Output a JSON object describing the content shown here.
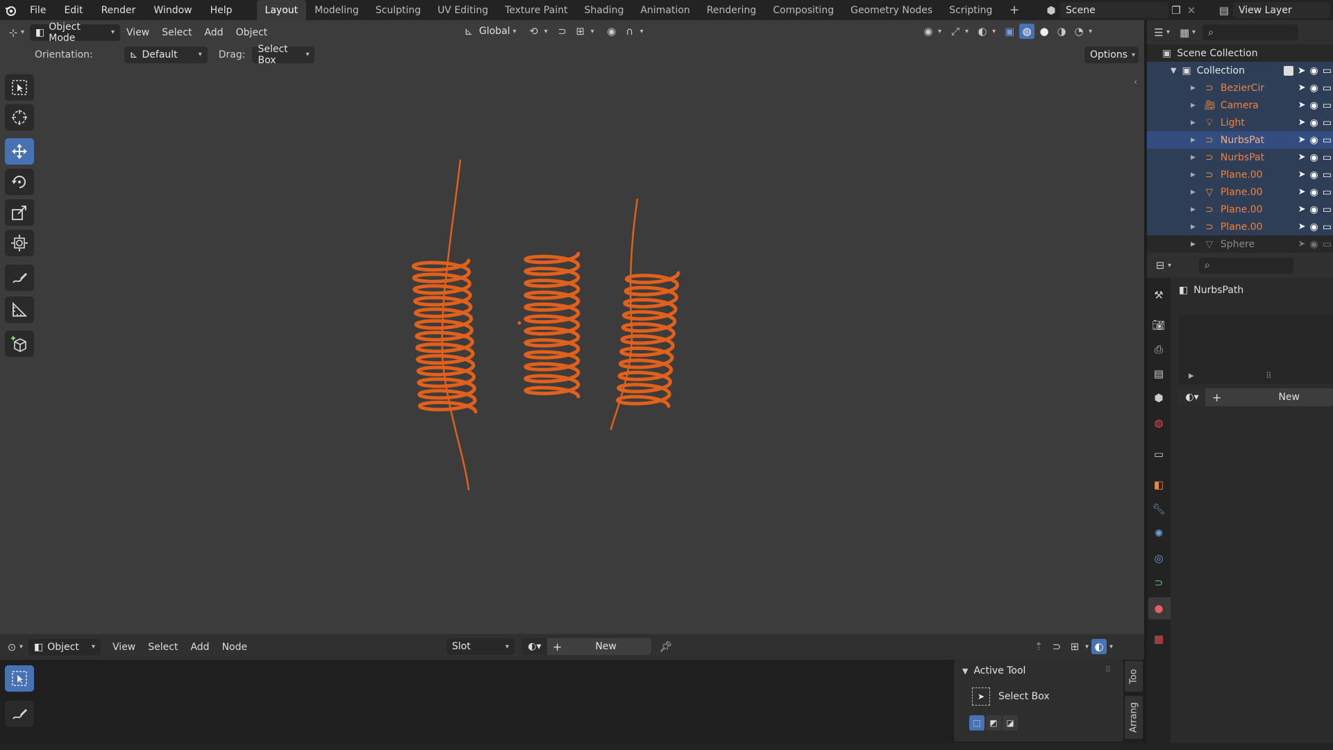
{
  "menus": [
    "File",
    "Edit",
    "Render",
    "Window",
    "Help"
  ],
  "workspaces": [
    "Layout",
    "Modeling",
    "Sculpting",
    "UV Editing",
    "Texture Paint",
    "Shading",
    "Animation",
    "Rendering",
    "Compositing",
    "Geometry Nodes",
    "Scripting"
  ],
  "active_workspace": "Layout",
  "scene": {
    "name": "Scene"
  },
  "view_layer": {
    "name": "View Layer"
  },
  "viewport_header": {
    "mode": "Object Mode",
    "menus": [
      "View",
      "Select",
      "Add",
      "Object"
    ],
    "orientation_transform": "Global"
  },
  "tool_header": {
    "orientation_label": "Orientation:",
    "orientation_value": "Default",
    "drag_label": "Drag:",
    "drag_value": "Select Box",
    "options": "Options"
  },
  "outliner": {
    "scene_collection": "Scene Collection",
    "collection": "Collection",
    "objects": [
      {
        "name": "BezierCir",
        "icon": "curve-icon"
      },
      {
        "name": "Camera",
        "icon": "camera-icon"
      },
      {
        "name": "Light",
        "icon": "light-icon"
      },
      {
        "name": "NurbsPat",
        "icon": "curve-icon"
      },
      {
        "name": "NurbsPat",
        "icon": "curve-icon"
      },
      {
        "name": "Plane.00",
        "icon": "curve-icon"
      },
      {
        "name": "Plane.00",
        "icon": "mesh-icon"
      },
      {
        "name": "Plane.00",
        "icon": "curve-icon"
      },
      {
        "name": "Plane.00",
        "icon": "curve-icon"
      },
      {
        "name": "Sphere",
        "icon": "mesh-icon"
      }
    ]
  },
  "properties": {
    "object_name": "NurbsPath",
    "new_label": "New"
  },
  "shader_header": {
    "mode": "Object",
    "menus": [
      "View",
      "Select",
      "Add",
      "Node"
    ],
    "slot": "Slot",
    "new_label": "New"
  },
  "npanel": {
    "section": "Active Tool",
    "tool": "Select Box",
    "tabs": [
      "Too",
      "Arrang"
    ]
  },
  "colors": {
    "accent": "#4772b3",
    "object_orange": "#e0601c",
    "outliner_text": "#f0833f"
  }
}
